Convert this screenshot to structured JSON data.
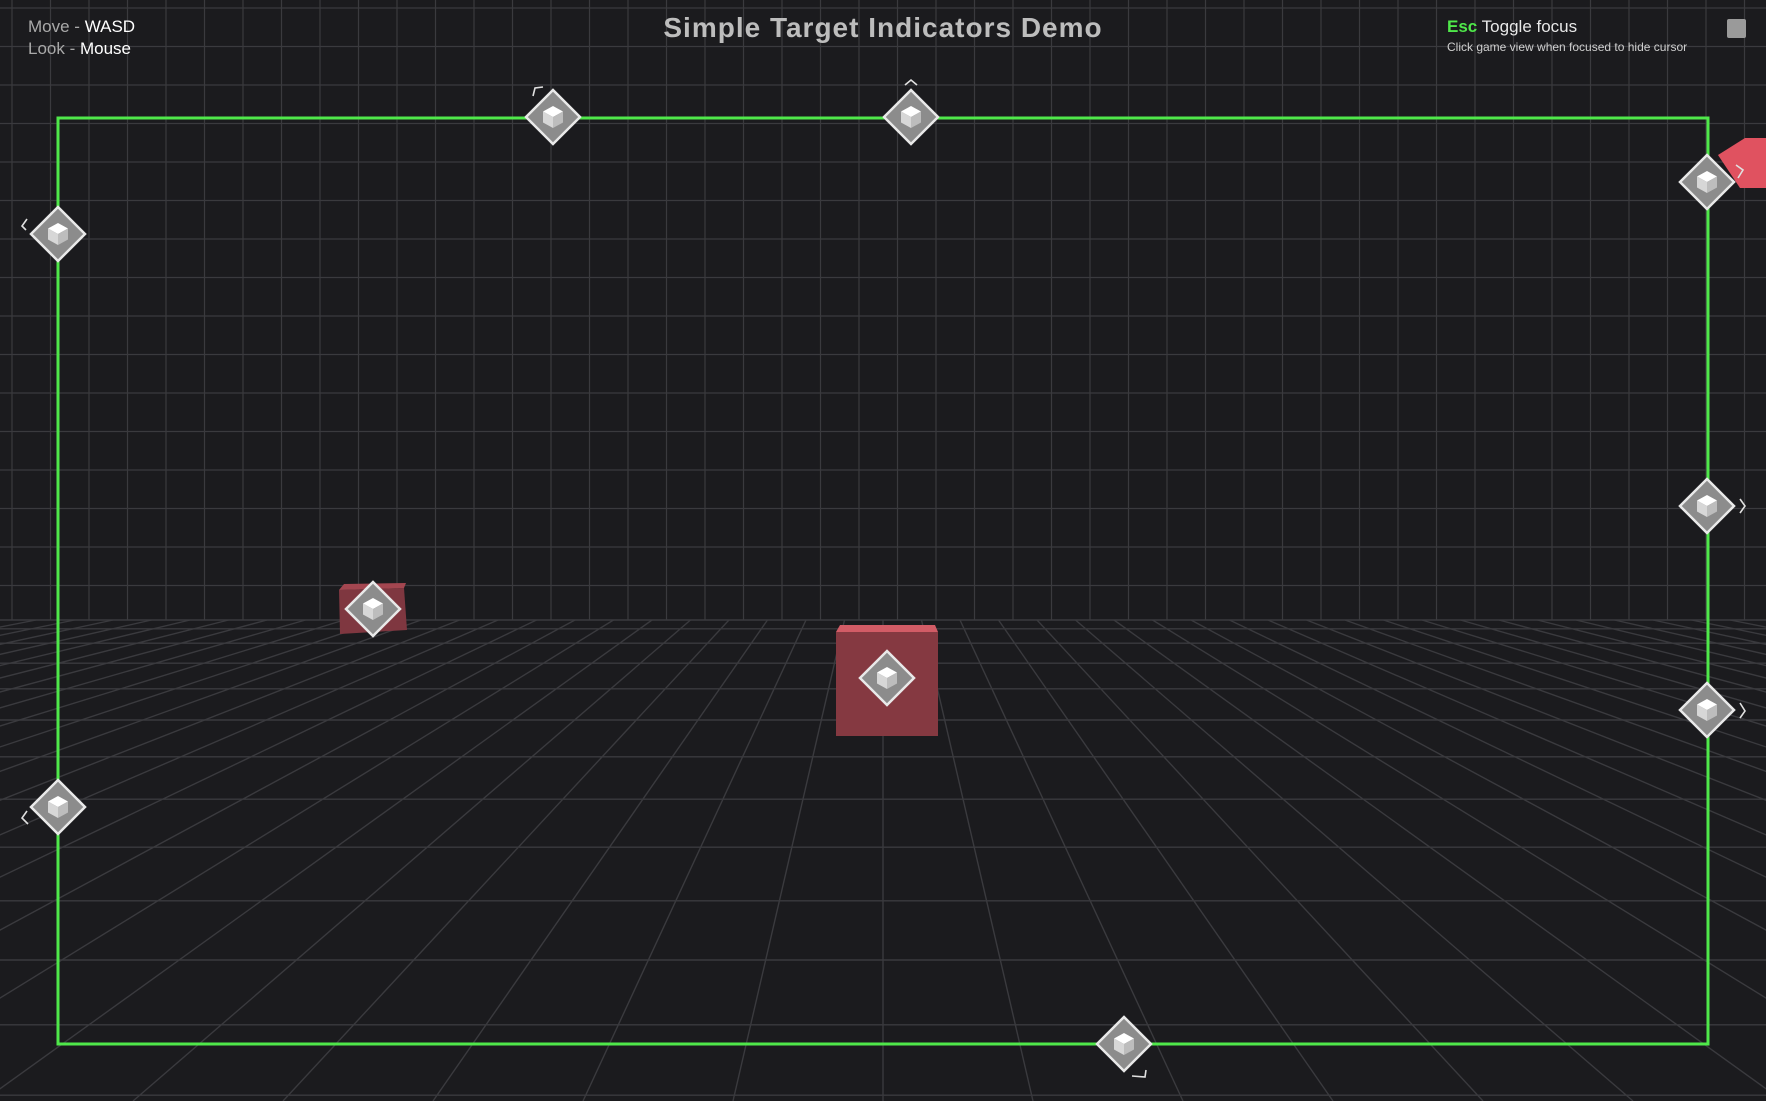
{
  "title": "Simple Target Indicators Demo",
  "controls": {
    "move_label": "Move - ",
    "move_key": "WASD",
    "look_label": "Look - ",
    "look_key": "Mouse"
  },
  "focus": {
    "key": "Esc",
    "label": "Toggle focus",
    "hint": "Click game view when focused to hide cursor"
  },
  "colors": {
    "background": "#1b1b1e",
    "grid": "#3a3a3e",
    "screen_bounds": "#4fe84a",
    "target_cube": "#8a3a45",
    "target_cube_top": "#d05a64",
    "indicator": "#8c8c8c",
    "accent": "#4fe84a"
  },
  "indicators": [
    {
      "icon": "cube-icon",
      "state": "offscreen",
      "direction": "top-left"
    },
    {
      "icon": "cube-icon",
      "state": "offscreen",
      "direction": "top"
    },
    {
      "icon": "cube-icon",
      "state": "offscreen",
      "direction": "top-right"
    },
    {
      "icon": "cube-icon",
      "state": "offscreen",
      "direction": "left"
    },
    {
      "icon": "cube-icon",
      "state": "offscreen",
      "direction": "right"
    },
    {
      "icon": "cube-icon",
      "state": "offscreen",
      "direction": "right"
    },
    {
      "icon": "cube-icon",
      "state": "offscreen",
      "direction": "left"
    },
    {
      "icon": "cube-icon",
      "state": "offscreen",
      "direction": "bottom"
    },
    {
      "icon": "cube-icon",
      "state": "onscreen",
      "direction": "none"
    },
    {
      "icon": "cube-icon",
      "state": "onscreen",
      "direction": "none"
    }
  ]
}
